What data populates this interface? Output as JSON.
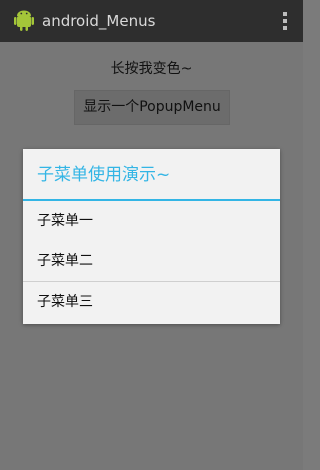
{
  "app": {
    "title": "android_Menus",
    "icon": "android-icon",
    "overflow_icon": "more-vert-icon"
  },
  "main": {
    "longpress_text": "长按我变色~",
    "popup_button_label": "显示一个PopupMenu"
  },
  "dialog": {
    "title": "子菜单使用演示~",
    "accent_color": "#33b5e5",
    "items": [
      {
        "label": "子菜单一"
      },
      {
        "label": "子菜单二"
      },
      {
        "label": "子菜单三"
      }
    ]
  }
}
